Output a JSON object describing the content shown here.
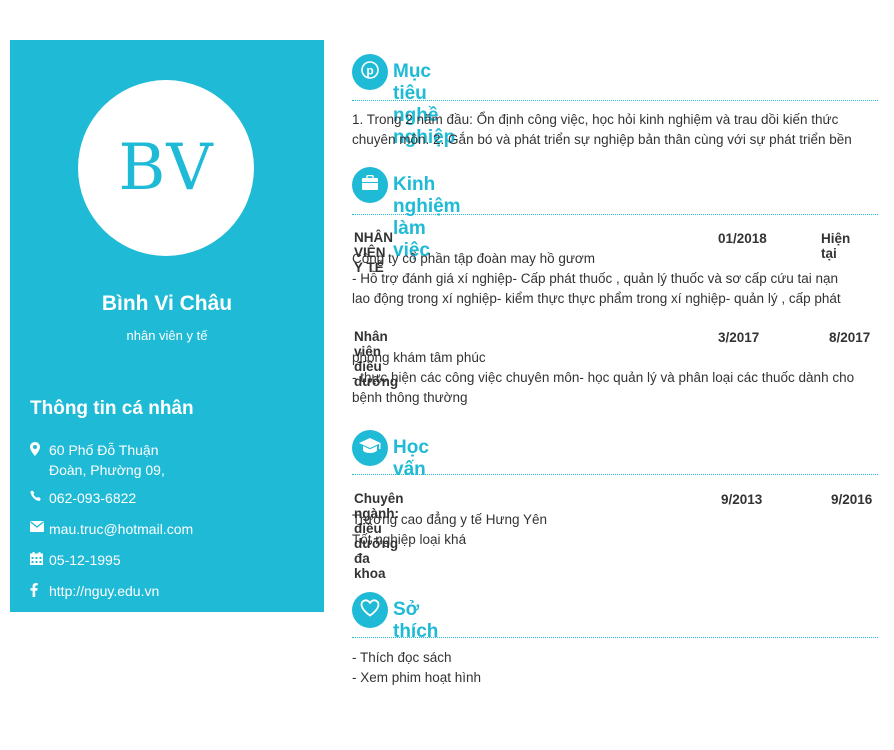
{
  "profile": {
    "initials": "BV",
    "name": "Bình Vi Châu",
    "job_title": "nhân viên y tế"
  },
  "personal": {
    "title": "Thông tin cá nhân",
    "address_line1": "60 Phố Đỗ Thuận",
    "address_line2": "Đoàn, Phường 09,",
    "phone": "062-093-6822",
    "email": "mau.truc@hotmail.com",
    "dob": "05-12-1995",
    "website": "http://nguy.edu.vn"
  },
  "objective": {
    "title": "Mục tiêu nghề nghiệp",
    "line1": "1. Trong 2 năm đầu: Ổn định công việc, học hỏi kinh nghiệm và trau dồi kiến thức",
    "line2": "chuyên môn. 2. Gắn bó và phát triển sự nghiệp bản thân cùng với sự phát triển bền"
  },
  "experience": {
    "title": "Kinh nghiệm làm việc",
    "jobs": [
      {
        "position": "NHÂN VIÊN Y TẾ",
        "start": "01/2018",
        "end": "Hiện tại",
        "company": "Công ty cổ phần tập đoàn may  hồ gươm",
        "desc_line1": "- Hỗ trợ đánh giá xí nghiệp- Cấp phát thuốc , quản lý thuốc và sơ cấp cứu tai nạn",
        "desc_line2": "lao động trong xí nghiệp-  kiểm thực thực phẩm trong xí nghiệp- quản lý , cấp phát"
      },
      {
        "position": "Nhân viên điều dưỡng",
        "start": "3/2017",
        "end": "8/2017",
        "company": "phòng khám tâm phúc",
        "desc_line1": "- thực hiện các công việc chuyên môn- học quản lý và phân loại các thuốc dành cho",
        "desc_line2": "bệnh thông thường"
      }
    ]
  },
  "education": {
    "title": "Học vấn",
    "major": "Chuyên ngành: điều dưỡng đa khoa",
    "start": "9/2013",
    "end": "9/2016",
    "school": "Trường cao đẳng y tế Hưng Yên",
    "result": "Tốt nghiệp loại khá"
  },
  "hobbies": {
    "title": "Sở thích",
    "items": [
      "- Thích đọc sách",
      "- Xem phim hoạt hình"
    ]
  },
  "colors": {
    "accent": "#1fbad6",
    "text": "#333333"
  }
}
